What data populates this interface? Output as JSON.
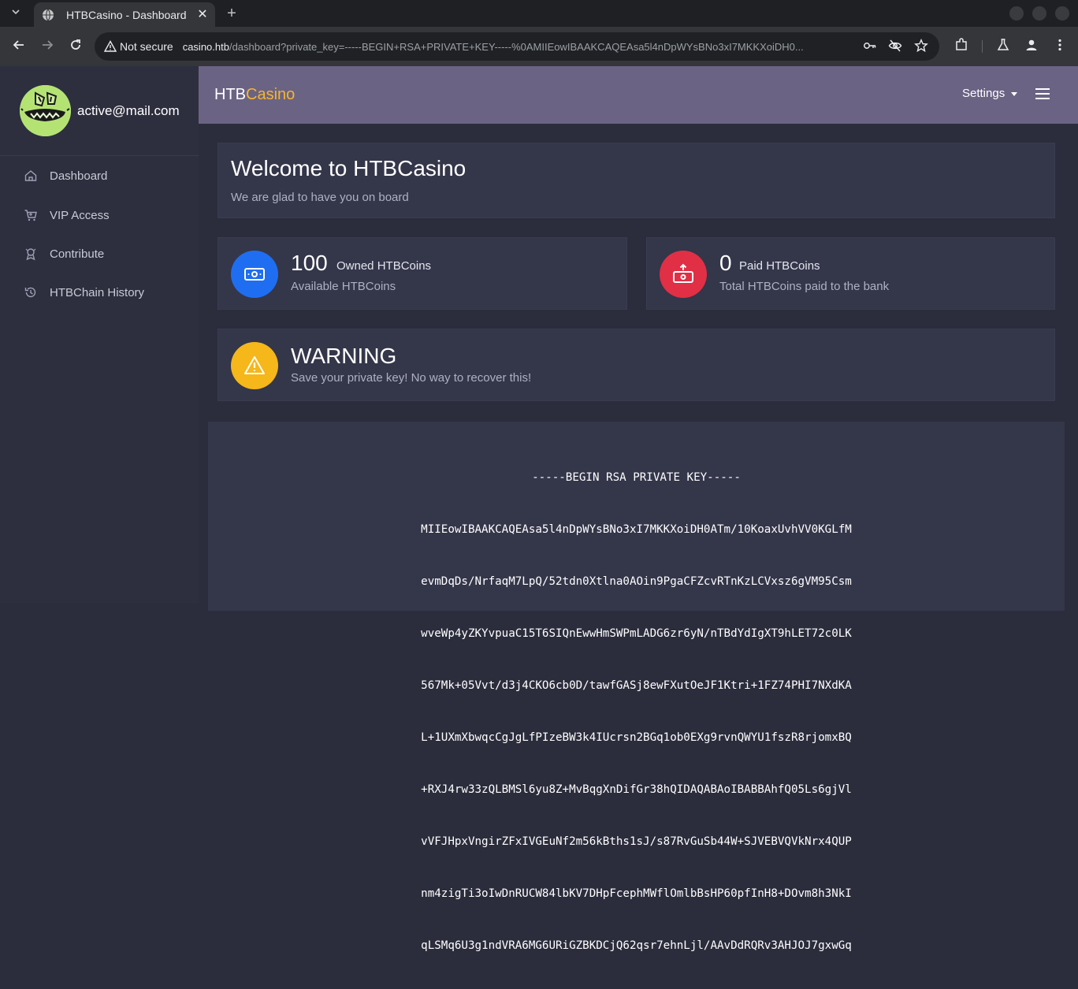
{
  "browser": {
    "tab_title": "HTBCasino - Dashboard",
    "security_label": "Not secure",
    "url_host": "casino.htb",
    "url_rest": "/dashboard?private_key=-----BEGIN+RSA+PRIVATE+KEY-----%0AMIIEowIBAAKCAQEAsa5l4nDpWYsBNo3xI7MKKXoiDH0..."
  },
  "sidebar": {
    "email": "active@mail.com",
    "items": [
      {
        "label": "Dashboard"
      },
      {
        "label": "VIP Access"
      },
      {
        "label": "Contribute"
      },
      {
        "label": "HTBChain History"
      }
    ]
  },
  "header": {
    "brand_prefix": "HTB",
    "brand_accent": "Casino",
    "settings_label": "Settings"
  },
  "welcome": {
    "title": "Welcome to HTBCasino",
    "subtitle": "We are glad to have you on board"
  },
  "stats": {
    "owned": {
      "value": "100",
      "unit": "Owned HTBCoins",
      "desc": "Available HTBCoins"
    },
    "paid": {
      "value": "0",
      "unit": "Paid HTBCoins",
      "desc": "Total HTBCoins paid to the bank"
    }
  },
  "warning": {
    "title": "WARNING",
    "text": "Save your private key! No way to recover this!"
  },
  "private_key": {
    "header": "-----BEGIN RSA PRIVATE KEY-----",
    "lines": [
      "MIIEowIBAAKCAQEAsa5l4nDpWYsBNo3xI7MKKXoiDH0ATm/10KoaxUvhVV0KGLfM",
      "evmDqDs/NrfaqM7LpQ/52tdn0Xtlna0AOin9PgaCFZcvRTnKzLCVxsz6gVM95Csm",
      "wveWp4yZKYvpuaC15T6SIQnEwwHmSWPmLADG6zr6yN/nTBdYdIgXT9hLET72c0LK",
      "567Mk+05Vvt/d3j4CKO6cb0D/tawfGASj8ewFXutOeJF1Ktri+1FZ74PHI7NXdKA",
      "L+1UXmXbwqcCgJgLfPIzeBW3k4IUcrsn2BGq1ob0EXg9rvnQWYU1fszR8rjomxBQ",
      "+RXJ4rw33zQLBMSl6yu8Z+MvBqgXnDifGr38hQIDAQABAoIBABBAhfQ05Ls6gjVl",
      "vVFJHpxVngirZFxIVGEuNf2m56kBths1sJ/s87RvGuSb44W+SJVEBVQVkNrx4QUP",
      "nm4zigTi3oIwDnRUCW84lbKV7DHpFcephMWflOmlbBsHP60pfInH8+DOvm8h3NkI",
      "qLSMq6U3g1ndVRA6MG6URiGZBKDCjQ62qsr7ehnLjl/AAvDdRQRv3AHJOJ7gxwGq"
    ]
  }
}
